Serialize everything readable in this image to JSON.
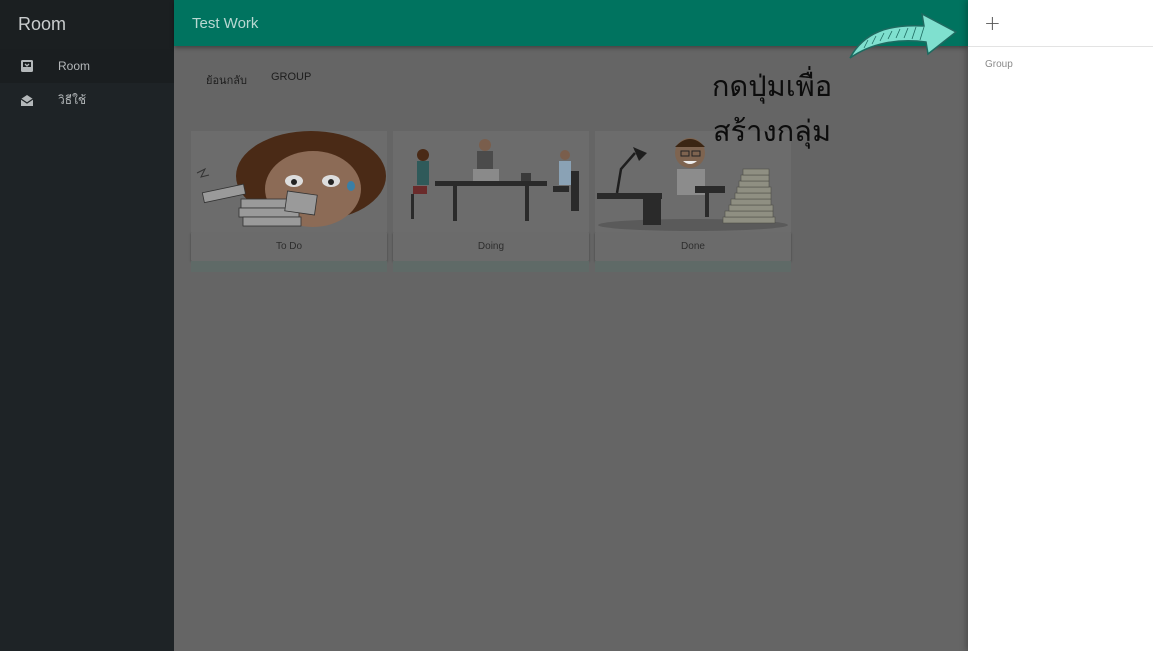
{
  "sidebar": {
    "title": "Room",
    "items": [
      {
        "label": "Room",
        "icon": "inbox-icon"
      },
      {
        "label": "วิธีใช้",
        "icon": "envelope-open-icon"
      }
    ]
  },
  "header": {
    "title": "Test Work"
  },
  "subnav": {
    "back": "ย้อนกลับ",
    "group": "GROUP"
  },
  "cards": [
    {
      "label": "To Do",
      "image": "stressed-woman-with-papers"
    },
    {
      "label": "Doing",
      "image": "office-meeting-table"
    },
    {
      "label": "Done",
      "image": "happy-man-at-desk"
    }
  ],
  "hint": {
    "line1": "กดปุ่มเพื่อ",
    "line2": "สร้างกลุ่ม"
  },
  "drawer": {
    "add_symbol": "+",
    "items": [
      "Group"
    ]
  },
  "colors": {
    "appbar": "#00735f",
    "sidebar": "#1e2326",
    "overlay_main": "#656565",
    "drawer": "#ffffff",
    "arrow": "#7fe0cf"
  }
}
